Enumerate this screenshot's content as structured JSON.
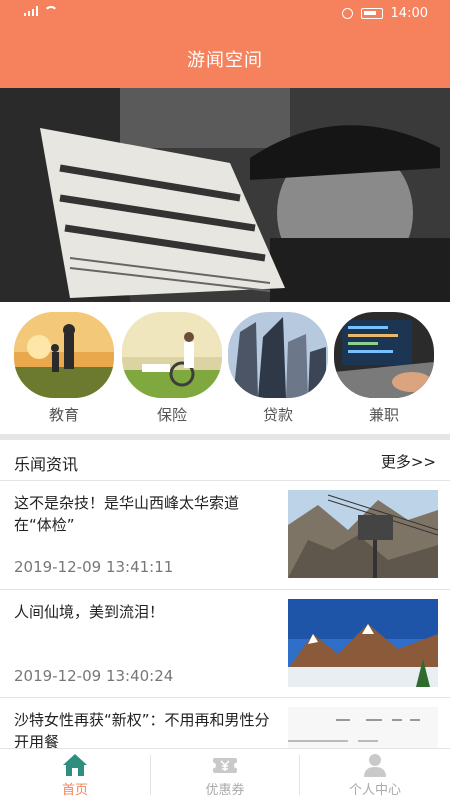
{
  "status": {
    "time": "14:00"
  },
  "header": {
    "title": "游闻空间"
  },
  "categories": [
    {
      "label": "教育"
    },
    {
      "label": "保险"
    },
    {
      "label": "贷款"
    },
    {
      "label": "兼职"
    }
  ],
  "news": {
    "section_title": "乐闻资讯",
    "more_label": "更多>>",
    "items": [
      {
        "title": "这不是杂技！是华山西峰太华索道在“体检”",
        "date": "2019-12-09 13:41:11"
      },
      {
        "title": "人间仙境，美到流泪！",
        "date": "2019-12-09 13:40:24"
      },
      {
        "title": "沙特女性再获“新权”：不用再和男性分开用餐",
        "date": ""
      }
    ]
  },
  "tabs": [
    {
      "label": "首页",
      "active": true
    },
    {
      "label": "优惠券",
      "active": false
    },
    {
      "label": "个人中心",
      "active": false
    }
  ],
  "colors": {
    "brand": "#f5825c",
    "active_tab_icon": "#2f8f7f"
  }
}
